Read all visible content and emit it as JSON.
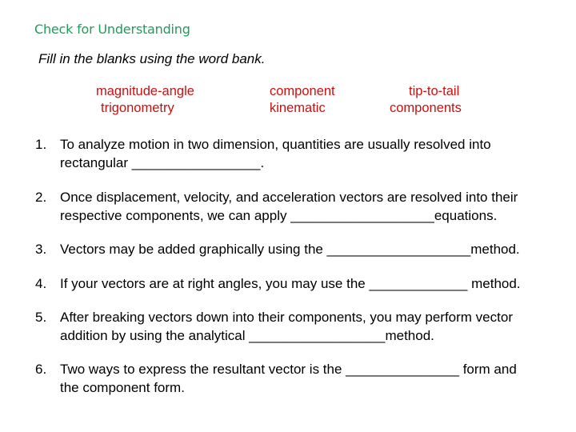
{
  "title": "Check for Understanding",
  "instructions": "Fill in the blanks using the word bank.",
  "word_bank": {
    "col1": [
      "magnitude-angle",
      "trigonometry"
    ],
    "col2": [
      "component",
      "kinematic"
    ],
    "col3": [
      "tip-to-tail",
      "components"
    ]
  },
  "questions": [
    {
      "num": "1.",
      "line1": "To analyze motion in two dimension, quantities are usually resolved into",
      "line2": "rectangular _________________."
    },
    {
      "num": "2.",
      "line1": "Once displacement, velocity, and acceleration vectors are resolved into their",
      "line2": "respective components, we can apply ___________________equations."
    },
    {
      "num": "3.",
      "line1": "Vectors may be added graphically using the ___________________method."
    },
    {
      "num": "4.",
      "line1": "If your vectors are at right angles, you may use the _____________ method."
    },
    {
      "num": "5.",
      "line1": "After breaking vectors down into their components, you may perform vector",
      "line2": "addition by using the analytical __________________method."
    },
    {
      "num": "6.",
      "line1": "Two ways to express the resultant vector is the _______________ form and",
      "line2": "the component form."
    }
  ]
}
